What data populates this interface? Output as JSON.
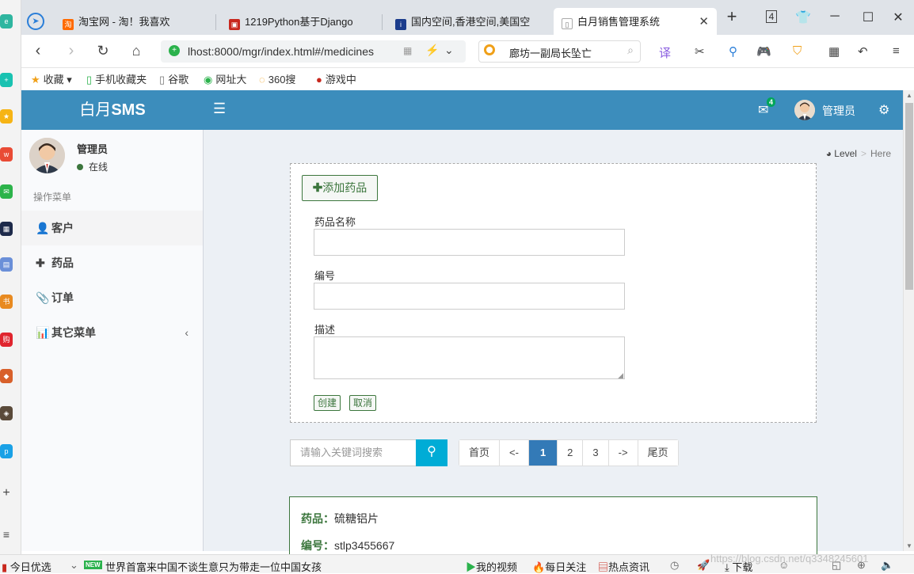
{
  "browser": {
    "tabs": [
      {
        "label": "淘宝网 - 淘！我喜欢",
        "icon": "taobao-icon"
      },
      {
        "label": "1219Python基于Django",
        "icon": "doc-icon"
      },
      {
        "label": "国内空间,香港空间,美国空",
        "icon": "idc-icon"
      },
      {
        "label": "白月销售管理系统",
        "icon": "page-icon"
      }
    ],
    "tab_count": "4",
    "url": "lhost:8000/mgr/index.html#/medicines",
    "search_text": "廊坊一副局长坠亡",
    "bookmarks": [
      "收藏",
      "手机收藏夹",
      "谷歌",
      "网址大",
      "360搜",
      "游戏中"
    ]
  },
  "app": {
    "logo_prefix": "白月",
    "logo_suffix": "SMS",
    "mail_count": "4",
    "user_name": "管理员"
  },
  "sidebar": {
    "user_name": "管理员",
    "status": "在线",
    "menu_header": "操作菜单",
    "items": [
      {
        "label": "客户",
        "icon": "user-icon"
      },
      {
        "label": "药品",
        "icon": "plus-icon"
      },
      {
        "label": "订单",
        "icon": "paperclip-icon"
      },
      {
        "label": "其它菜单",
        "icon": "bar-chart-icon"
      }
    ]
  },
  "breadcrumb": {
    "level": "Level",
    "sep": ">",
    "current": "Here"
  },
  "form": {
    "add_button": "添加药品",
    "name_label": "药品名称",
    "code_label": "编号",
    "desc_label": "描述",
    "create_button": "创建",
    "cancel_button": "取消"
  },
  "search": {
    "placeholder": "请输入关键词搜索"
  },
  "pagination": [
    "首页",
    "<-",
    "1",
    "2",
    "3",
    "->",
    "尾页"
  ],
  "pagination_active": "1",
  "result": {
    "name_label": "药品：",
    "name_value": "硫糖铝片",
    "code_label": "编号：",
    "code_value": "stlp3455667"
  },
  "statusbar": {
    "left": "今日优选",
    "badge": "NEW",
    "news": "世界首富来中国不谈生意只为带走一位中国女孩",
    "items": [
      "我的视频",
      "每日关注",
      "热点资讯",
      "下载"
    ]
  },
  "watermark": "https://blog.csdn.net/q3348245601",
  "colors": {
    "header": "#3c8dbc",
    "accent_green": "#3c763d",
    "search_button": "#00acd6",
    "pager_active": "#337ab7"
  }
}
